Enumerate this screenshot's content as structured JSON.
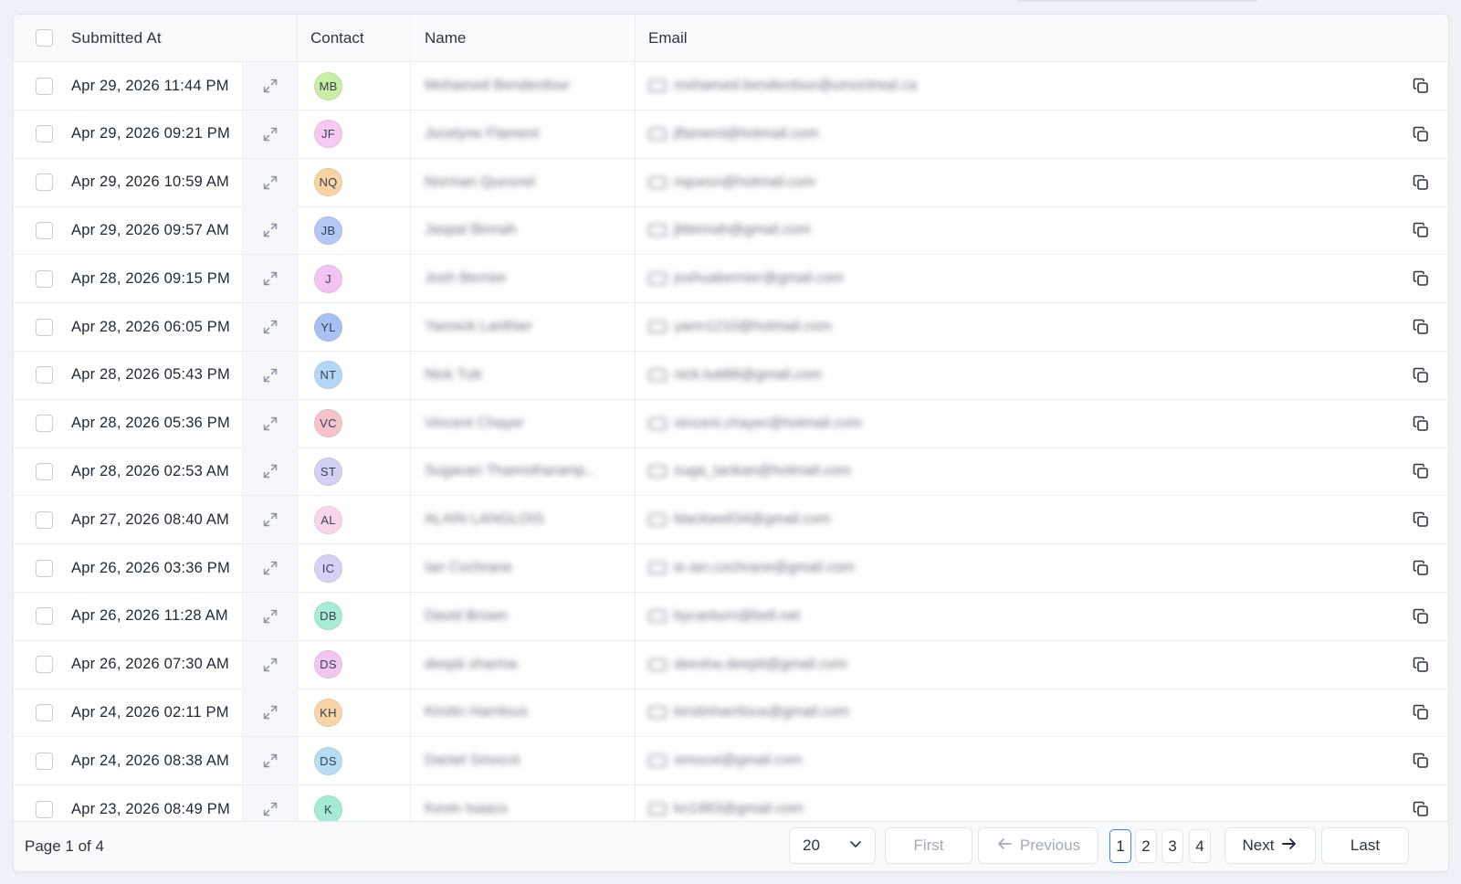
{
  "table": {
    "columns": {
      "submitted_at": "Submitted At",
      "contact": "Contact",
      "name": "Name",
      "email": "Email"
    },
    "rows": [
      {
        "date": "Apr 29, 2026 11:44 PM",
        "initials": "MB",
        "color": "#c9eea5",
        "name": "Mohamed Benderdour",
        "email": "mohamed.benderdour@umontreal.ca"
      },
      {
        "date": "Apr 29, 2026 09:21 PM",
        "initials": "JF",
        "color": "#f7c9f2",
        "name": "Jocelyne Flament",
        "email": "jflament@hotmail.com"
      },
      {
        "date": "Apr 29, 2026 10:59 AM",
        "initials": "NQ",
        "color": "#f8d3a4",
        "name": "Norman Quesnel",
        "email": "nquesn@hotmail.com"
      },
      {
        "date": "Apr 29, 2026 09:57 AM",
        "initials": "JB",
        "color": "#b3c8f5",
        "name": "Jaspal Binnah",
        "email": "jbbinnah@gmail.com"
      },
      {
        "date": "Apr 28, 2026 09:15 PM",
        "initials": "J",
        "color": "#f3c4f3",
        "name": "Josh Bernier",
        "email": "joshuabernier@gmail.com"
      },
      {
        "date": "Apr 28, 2026 06:05 PM",
        "initials": "YL",
        "color": "#a9c0f2",
        "name": "Yannick Lanthier",
        "email": "yann1210@hotmail.com"
      },
      {
        "date": "Apr 28, 2026 05:43 PM",
        "initials": "NT",
        "color": "#b4d6f7",
        "name": "Nick Tutt",
        "email": "nick.tutt88@gmail.com"
      },
      {
        "date": "Apr 28, 2026 05:36 PM",
        "initials": "VC",
        "color": "#f6c3cd",
        "name": "Vincent Chayer",
        "email": "vincent.chayer@hotmail.com"
      },
      {
        "date": "Apr 28, 2026 02:53 AM",
        "initials": "ST",
        "color": "#d4d0f4",
        "name": "Sugavan Thamotharamp...",
        "email": "suga_tankan@hotmail.com"
      },
      {
        "date": "Apr 27, 2026 08:40 AM",
        "initials": "AL",
        "color": "#fad4ea",
        "name": "ALAIN LANGLOIS",
        "email": "blackwell34@gmail.com"
      },
      {
        "date": "Apr 26, 2026 03:36 PM",
        "initials": "IC",
        "color": "#d8d1f5",
        "name": "Ian Cochrane",
        "email": "ie.ian.cochrane@gmail.com"
      },
      {
        "date": "Apr 26, 2026 11:28 AM",
        "initials": "DB",
        "color": "#a9ecd5",
        "name": "David Brown",
        "email": "bycanturn@bell.net"
      },
      {
        "date": "Apr 26, 2026 07:30 AM",
        "initials": "DS",
        "color": "#f2c6ee",
        "name": "deepti sharma",
        "email": "deesha.deepti@gmail.com"
      },
      {
        "date": "Apr 24, 2026 02:11 PM",
        "initials": "KH",
        "color": "#f8d5a9",
        "name": "Kirstin Harrilous",
        "email": "kirstinharrilous@gmail.com"
      },
      {
        "date": "Apr 24, 2026 08:38 AM",
        "initials": "DS",
        "color": "#b9dcf5",
        "name": "Daniel Smocot",
        "email": "smocot@gmail.com"
      },
      {
        "date": "Apr 23, 2026 08:49 PM",
        "initials": "K",
        "color": "#a5ead3",
        "name": "Kevin Isaacs",
        "email": "kn1983@gmail.com"
      }
    ]
  },
  "footer": {
    "page_info": "Page 1 of 4",
    "page_size": "20",
    "first": "First",
    "previous": "Previous",
    "pages": [
      "1",
      "2",
      "3",
      "4"
    ],
    "current_page": "1",
    "next": "Next",
    "last": "Last"
  },
  "icons": {
    "expand": "expand-arrows-icon",
    "copy": "copy-icon",
    "email": "mail-icon",
    "chevron": "chevron-down-icon",
    "arrow_left": "arrow-left-icon",
    "arrow_right": "arrow-right-icon"
  }
}
